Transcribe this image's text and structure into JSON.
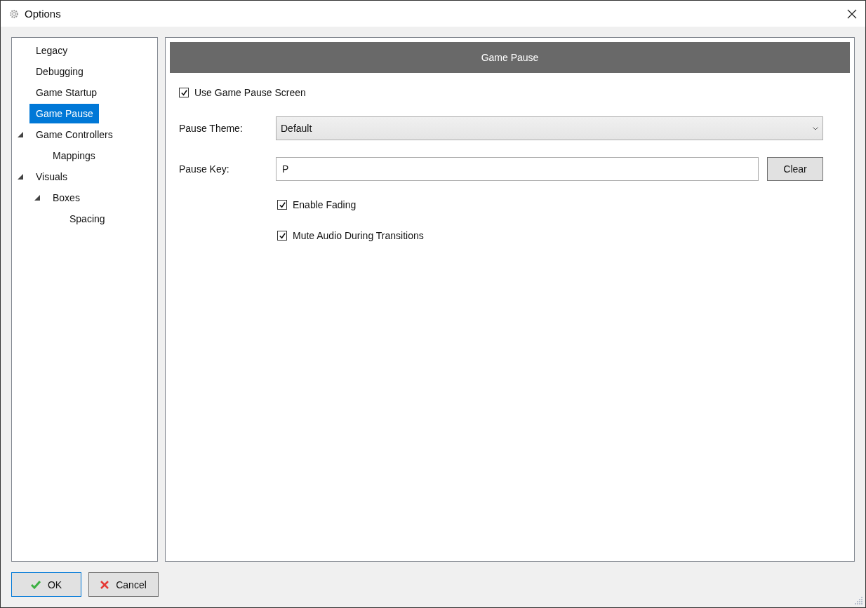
{
  "window": {
    "title": "Options"
  },
  "tree": {
    "items": [
      {
        "label": "Legacy",
        "selected": false
      },
      {
        "label": "Debugging",
        "selected": false
      },
      {
        "label": "Game Startup",
        "selected": false
      },
      {
        "label": "Game Pause",
        "selected": true
      },
      {
        "label": "Game Controllers",
        "selected": false,
        "expanded": true,
        "children": [
          {
            "label": "Mappings",
            "selected": false
          }
        ]
      },
      {
        "label": "Visuals",
        "selected": false,
        "expanded": true,
        "children": [
          {
            "label": "Boxes",
            "selected": false,
            "expanded": true,
            "children": [
              {
                "label": "Spacing",
                "selected": false
              }
            ]
          }
        ]
      }
    ]
  },
  "panel": {
    "header": "Game Pause",
    "use_screen": {
      "label": "Use Game Pause Screen",
      "checked": true
    },
    "theme": {
      "label": "Pause Theme:",
      "value": "Default"
    },
    "key": {
      "label": "Pause Key:",
      "value": "P",
      "button": "Clear"
    },
    "options": [
      {
        "label": "Enable Fading",
        "checked": true
      },
      {
        "label": "Mute Audio During Transitions",
        "checked": true
      }
    ]
  },
  "buttons": [
    {
      "kind": "ok",
      "label": "OK"
    },
    {
      "kind": "cancel",
      "label": "Cancel"
    }
  ]
}
